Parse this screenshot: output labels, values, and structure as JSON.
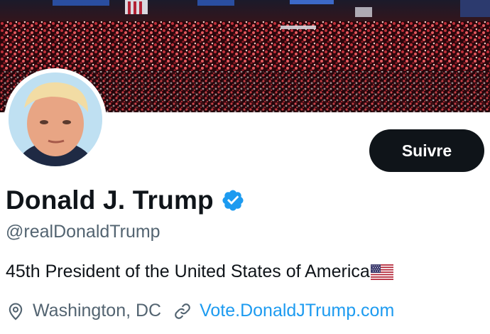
{
  "profile": {
    "display_name": "Donald J. Trump",
    "handle": "@realDonaldTrump",
    "bio": "45th President of the United States of America",
    "location": "Washington, DC",
    "website": "Vote.DonaldJTrump.com",
    "follow_label": "Suivre",
    "verified": true
  },
  "icons": {
    "verified": "verified-badge-icon",
    "location": "location-pin-icon",
    "link": "link-icon",
    "flag": "us-flag-icon"
  },
  "colors": {
    "accent": "#1d9bf0",
    "text_primary": "#0f1419",
    "text_secondary": "#536471",
    "button_bg": "#0f1419"
  }
}
